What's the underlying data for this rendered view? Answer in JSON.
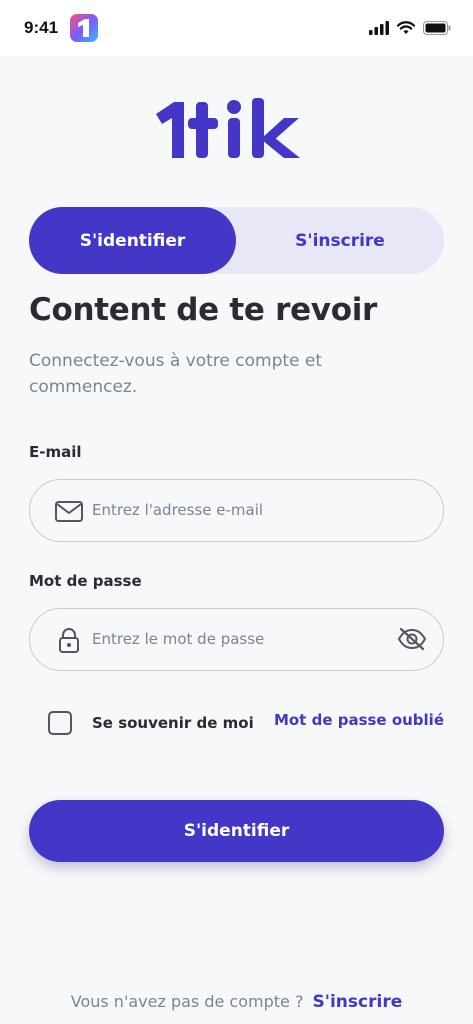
{
  "status_bar": {
    "time": "9:41",
    "icons": [
      "cellular-signal-icon",
      "wifi-icon",
      "battery-icon"
    ]
  },
  "brand": {
    "logo_text": "1tik",
    "primary_color": "#4437c8",
    "tab_track_color": "#e8e7f8"
  },
  "tabs": {
    "active": "S'identifier",
    "inactive": "S'inscrire"
  },
  "header": {
    "title": "Content de te revoir",
    "subtitle": "Connectez-vous à votre compte et commencez."
  },
  "form": {
    "email": {
      "label": "E-mail",
      "placeholder": "Entrez l'adresse e-mail",
      "value": "",
      "icon": "mail-icon"
    },
    "password": {
      "label": "Mot de passe",
      "placeholder": "Entrez le mot de passe",
      "value": "",
      "icon": "lock-icon",
      "toggle_icon": "eye-off-icon"
    },
    "remember_label": "Se souvenir de moi",
    "remember_checked": false,
    "forgot_label": "Mot de passe oublié",
    "submit_label": "S'identifier"
  },
  "footer": {
    "prompt": "Vous n'avez pas de compte ?",
    "link": "S'inscrire"
  }
}
